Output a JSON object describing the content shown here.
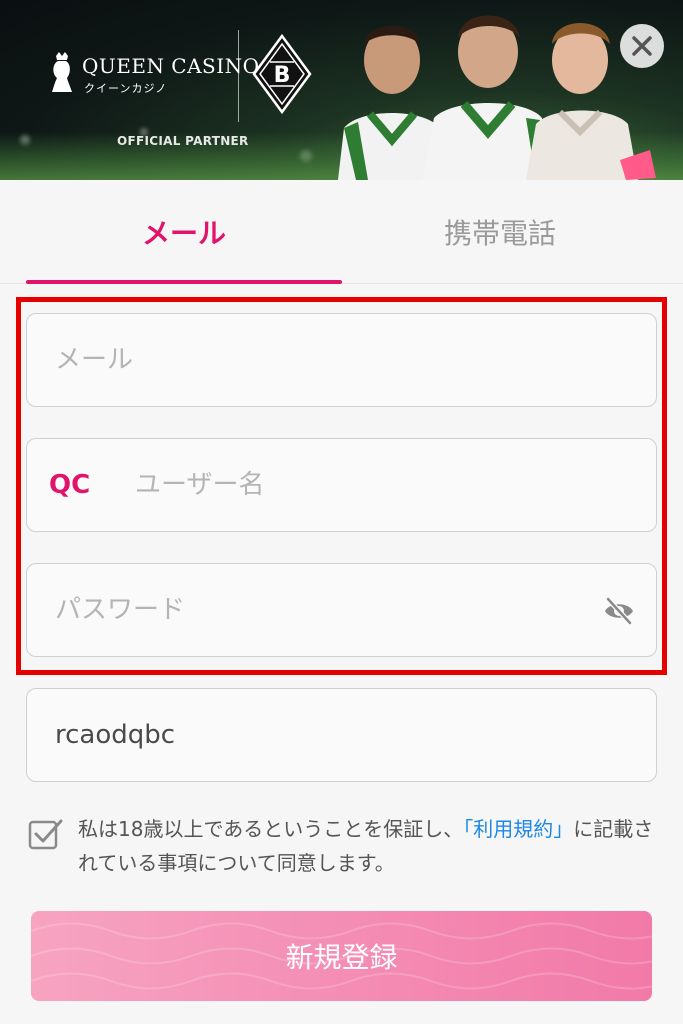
{
  "banner": {
    "brand_name": "QUEEN CASINO",
    "brand_katakana": "クイーンカジノ",
    "club_initial": "B",
    "partner_label": "OFFICIAL PARTNER",
    "close_icon": "close-icon"
  },
  "tabs": [
    {
      "label": "メール",
      "active": true
    },
    {
      "label": "携帯電話",
      "active": false
    }
  ],
  "form": {
    "email": {
      "placeholder": "メール",
      "value": ""
    },
    "username": {
      "prefix": "QC",
      "placeholder": "ユーザー名",
      "value": ""
    },
    "password": {
      "placeholder": "パスワード",
      "value": "",
      "toggle_icon": "eye-off-icon"
    },
    "invite_code": {
      "placeholder": "",
      "value": "rcaodqbc"
    }
  },
  "consent": {
    "checked": true,
    "text_before": "私は18歳以上であるということを保証し、",
    "terms_link": "「利用規約」",
    "text_after": "に記載されている事項について同意します。"
  },
  "submit": {
    "label": "新規登録"
  },
  "colors": {
    "accent": "#e0146b",
    "highlight_border": "#e60000",
    "link": "#1e88e5",
    "button_start": "#f7a4c1",
    "button_end": "#f27aa8"
  }
}
